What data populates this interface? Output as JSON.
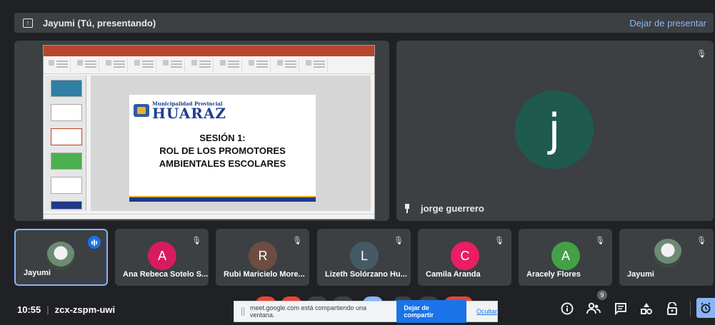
{
  "presentation_bar": {
    "title": "Jayumi (Tú, presentando)",
    "stop_label": "Dejar de presentar"
  },
  "slide": {
    "logo_small": "Municipalidad Provincial",
    "logo_big": "HUARAZ",
    "line1": "SESIÓN 1:",
    "line2": "ROL DE LOS PROMOTORES",
    "line3": "AMBIENTALES ESCOLARES"
  },
  "featured": {
    "initial": "j",
    "name": "jorge guerrero",
    "avatar_color": "#1e5b4e"
  },
  "participants": [
    {
      "name": "Jayumi",
      "type": "photo",
      "speaking": true
    },
    {
      "name": "Ana Rebeca Sotelo S...",
      "initial": "A",
      "color": "#d81b60"
    },
    {
      "name": "Rubi Maricielo More...",
      "initial": "R",
      "color": "#6d4c41"
    },
    {
      "name": "Lizeth Solórzano Hu...",
      "initial": "L",
      "color": "#455a64"
    },
    {
      "name": "Camila Aranda",
      "initial": "C",
      "color": "#e91e63"
    },
    {
      "name": "Aracely Flores",
      "initial": "A",
      "color": "#43a047"
    },
    {
      "name": "Jayumi",
      "type": "photo"
    }
  ],
  "footer": {
    "time": "10:55",
    "meeting_code": "zcx-zspm-uwi",
    "people_count": "9"
  },
  "share_notice": {
    "text": "meet.google.com está compartiendo una ventana.",
    "stop_label": "Dejar de compartir",
    "hide_label": "Ocultar"
  },
  "colors": {
    "accent": "#8ab4f8",
    "button_blue": "#1a73e8",
    "panel": "#3c4043",
    "background": "#202124"
  }
}
